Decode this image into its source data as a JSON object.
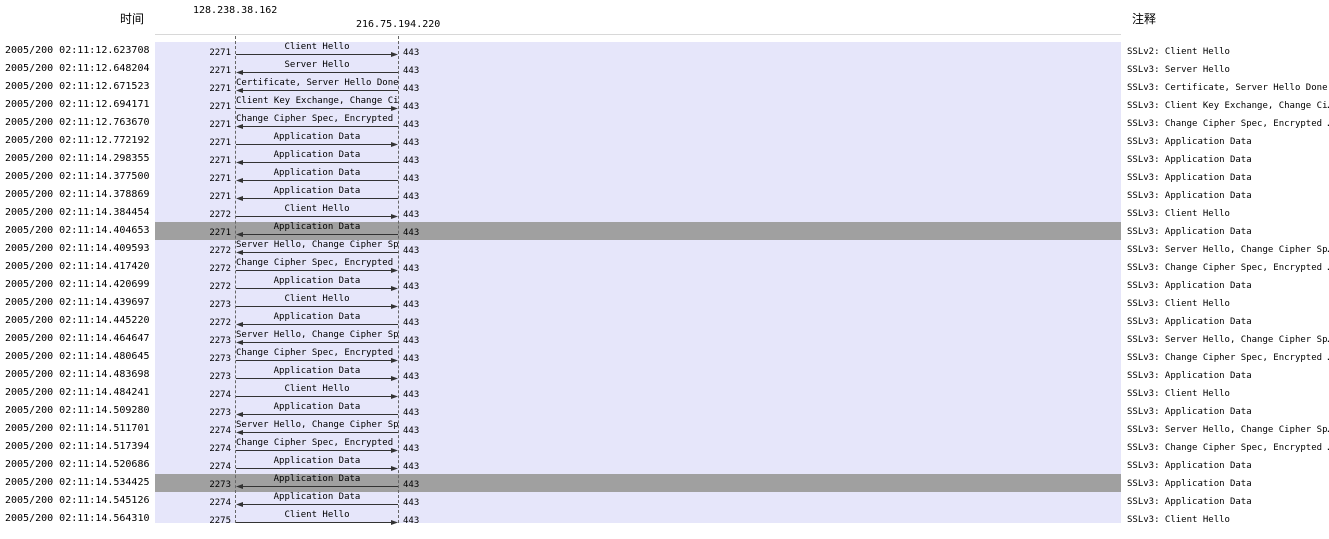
{
  "headers": {
    "time": "时间",
    "host_a": "128.238.38.162",
    "host_b": "216.75.194.220",
    "comment": "注释"
  },
  "colors": {
    "graph_background": "#e6e6fa",
    "highlight_row": "#a0a0a0",
    "arrow": "#333333"
  },
  "rows": [
    {
      "time": "2005/200 02:11:12.623708",
      "port_a": "2271",
      "port_b": "443",
      "label": "Client Hello",
      "dir": "right",
      "note": "SSLv2: Client Hello",
      "hl": false
    },
    {
      "time": "2005/200 02:11:12.648204",
      "port_a": "2271",
      "port_b": "443",
      "label": "Server Hello",
      "dir": "left",
      "note": "SSLv3: Server Hello",
      "hl": false
    },
    {
      "time": "2005/200 02:11:12.671523",
      "port_a": "2271",
      "port_b": "443",
      "label": "Certificate, Server Hello Done",
      "dir": "left",
      "note": "SSLv3: Certificate, Server Hello Done",
      "hl": false
    },
    {
      "time": "2005/200 02:11:12.694171",
      "port_a": "2271",
      "port_b": "443",
      "label": "Client Key Exchange, Change Ci…",
      "dir": "right",
      "note": "SSLv3: Client Key Exchange, Change Ci…",
      "hl": false
    },
    {
      "time": "2005/200 02:11:12.763670",
      "port_a": "2271",
      "port_b": "443",
      "label": "Change Cipher Spec, Encrypted …",
      "dir": "left",
      "note": "SSLv3: Change Cipher Spec, Encrypted …",
      "hl": false
    },
    {
      "time": "2005/200 02:11:12.772192",
      "port_a": "2271",
      "port_b": "443",
      "label": "Application Data",
      "dir": "right",
      "note": "SSLv3: Application Data",
      "hl": false
    },
    {
      "time": "2005/200 02:11:14.298355",
      "port_a": "2271",
      "port_b": "443",
      "label": "Application Data",
      "dir": "left",
      "note": "SSLv3: Application Data",
      "hl": false
    },
    {
      "time": "2005/200 02:11:14.377500",
      "port_a": "2271",
      "port_b": "443",
      "label": "Application Data",
      "dir": "left",
      "note": "SSLv3: Application Data",
      "hl": false
    },
    {
      "time": "2005/200 02:11:14.378869",
      "port_a": "2271",
      "port_b": "443",
      "label": "Application Data",
      "dir": "left",
      "note": "SSLv3: Application Data",
      "hl": false
    },
    {
      "time": "2005/200 02:11:14.384454",
      "port_a": "2272",
      "port_b": "443",
      "label": "Client Hello",
      "dir": "right",
      "note": "SSLv3: Client Hello",
      "hl": false
    },
    {
      "time": "2005/200 02:11:14.404653",
      "port_a": "2271",
      "port_b": "443",
      "label": "Application Data",
      "dir": "left",
      "note": "SSLv3: Application Data",
      "hl": true
    },
    {
      "time": "2005/200 02:11:14.409593",
      "port_a": "2272",
      "port_b": "443",
      "label": "Server Hello, Change Cipher Sp…",
      "dir": "left",
      "note": "SSLv3: Server Hello, Change Cipher Sp…",
      "hl": false
    },
    {
      "time": "2005/200 02:11:14.417420",
      "port_a": "2272",
      "port_b": "443",
      "label": "Change Cipher Spec, Encrypted …",
      "dir": "right",
      "note": "SSLv3: Change Cipher Spec, Encrypted …",
      "hl": false
    },
    {
      "time": "2005/200 02:11:14.420699",
      "port_a": "2272",
      "port_b": "443",
      "label": "Application Data",
      "dir": "right",
      "note": "SSLv3: Application Data",
      "hl": false
    },
    {
      "time": "2005/200 02:11:14.439697",
      "port_a": "2273",
      "port_b": "443",
      "label": "Client Hello",
      "dir": "right",
      "note": "SSLv3: Client Hello",
      "hl": false
    },
    {
      "time": "2005/200 02:11:14.445220",
      "port_a": "2272",
      "port_b": "443",
      "label": "Application Data",
      "dir": "left",
      "note": "SSLv3: Application Data",
      "hl": false
    },
    {
      "time": "2005/200 02:11:14.464647",
      "port_a": "2273",
      "port_b": "443",
      "label": "Server Hello, Change Cipher Sp…",
      "dir": "left",
      "note": "SSLv3: Server Hello, Change Cipher Sp…",
      "hl": false
    },
    {
      "time": "2005/200 02:11:14.480645",
      "port_a": "2273",
      "port_b": "443",
      "label": "Change Cipher Spec, Encrypted …",
      "dir": "right",
      "note": "SSLv3: Change Cipher Spec, Encrypted …",
      "hl": false
    },
    {
      "time": "2005/200 02:11:14.483698",
      "port_a": "2273",
      "port_b": "443",
      "label": "Application Data",
      "dir": "right",
      "note": "SSLv3: Application Data",
      "hl": false
    },
    {
      "time": "2005/200 02:11:14.484241",
      "port_a": "2274",
      "port_b": "443",
      "label": "Client Hello",
      "dir": "right",
      "note": "SSLv3: Client Hello",
      "hl": false
    },
    {
      "time": "2005/200 02:11:14.509280",
      "port_a": "2273",
      "port_b": "443",
      "label": "Application Data",
      "dir": "left",
      "note": "SSLv3: Application Data",
      "hl": false
    },
    {
      "time": "2005/200 02:11:14.511701",
      "port_a": "2274",
      "port_b": "443",
      "label": "Server Hello, Change Cipher Sp…",
      "dir": "left",
      "note": "SSLv3: Server Hello, Change Cipher Sp…",
      "hl": false
    },
    {
      "time": "2005/200 02:11:14.517394",
      "port_a": "2274",
      "port_b": "443",
      "label": "Change Cipher Spec, Encrypted …",
      "dir": "right",
      "note": "SSLv3: Change Cipher Spec, Encrypted …",
      "hl": false
    },
    {
      "time": "2005/200 02:11:14.520686",
      "port_a": "2274",
      "port_b": "443",
      "label": "Application Data",
      "dir": "right",
      "note": "SSLv3: Application Data",
      "hl": false
    },
    {
      "time": "2005/200 02:11:14.534425",
      "port_a": "2273",
      "port_b": "443",
      "label": "Application Data",
      "dir": "left",
      "note": "SSLv3: Application Data",
      "hl": true
    },
    {
      "time": "2005/200 02:11:14.545126",
      "port_a": "2274",
      "port_b": "443",
      "label": "Application Data",
      "dir": "left",
      "note": "SSLv3: Application Data",
      "hl": false
    },
    {
      "time": "2005/200 02:11:14.564310",
      "port_a": "2275",
      "port_b": "443",
      "label": "Client Hello",
      "dir": "right",
      "note": "SSLv3: Client Hello",
      "hl": false
    }
  ]
}
